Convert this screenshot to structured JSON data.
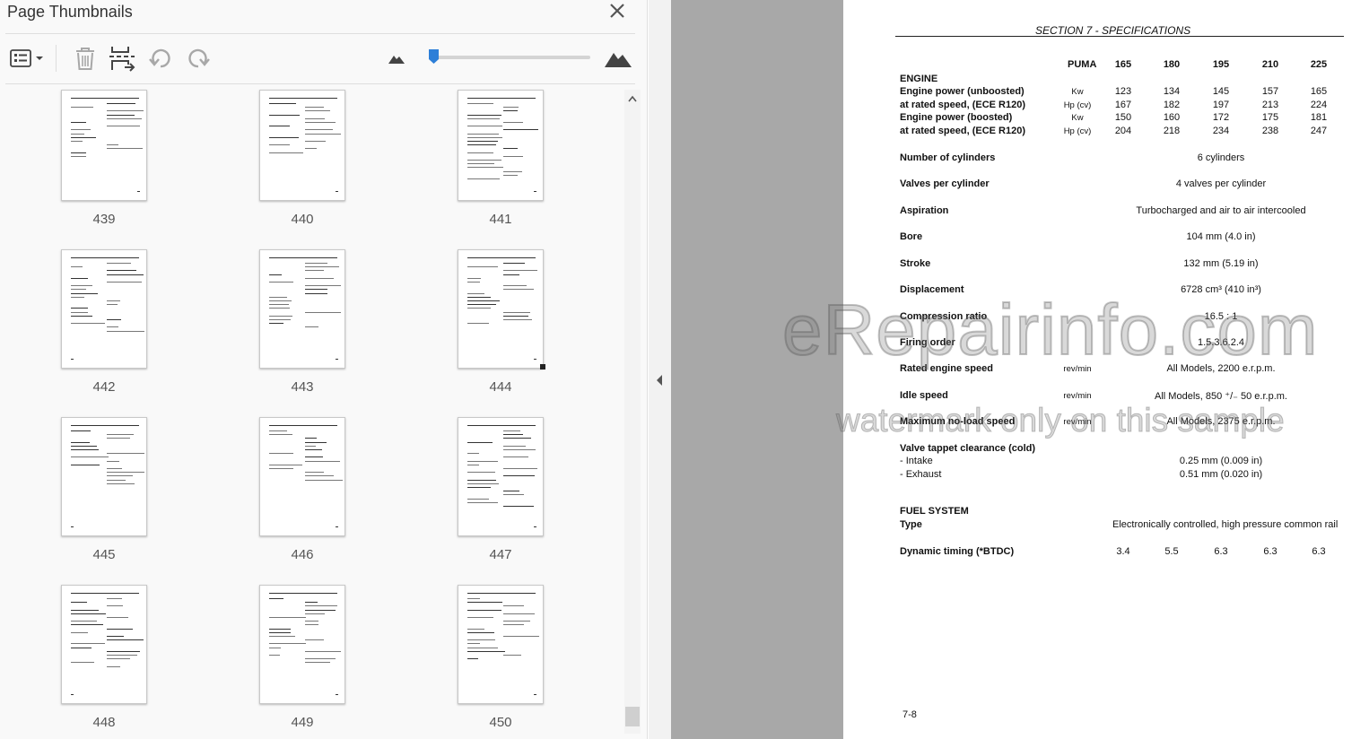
{
  "panel": {
    "title": "Page Thumbnails",
    "toolbar": {
      "options_icon": "thumbnail-options-icon",
      "delete_icon": "trash-icon",
      "extract_icon": "extract-pages-icon",
      "rotate_left_icon": "rotate-counterclockwise-icon",
      "rotate_right_icon": "rotate-clockwise-icon",
      "zoom_out_icon": "small-mountain-icon",
      "zoom_in_icon": "large-mountain-icon",
      "zoom_level": 0.03
    },
    "thumbnails": [
      {
        "label": "439"
      },
      {
        "label": "440"
      },
      {
        "label": "441"
      },
      {
        "label": "442"
      },
      {
        "label": "443"
      },
      {
        "label": "444",
        "selected": true
      },
      {
        "label": "445"
      },
      {
        "label": "446"
      },
      {
        "label": "447"
      },
      {
        "label": "448"
      },
      {
        "label": "449"
      },
      {
        "label": "450"
      }
    ]
  },
  "document": {
    "section_header": "SECTION 7  - SPECIFICATIONS",
    "model_header": "PUMA",
    "models": [
      "165",
      "180",
      "195",
      "210",
      "225"
    ],
    "engine_heading": "ENGINE",
    "power_rows": [
      {
        "label": "Engine power (unboosted)",
        "unit": "Kw",
        "values": [
          "123",
          "134",
          "145",
          "157",
          "165"
        ]
      },
      {
        "label": "at rated speed, (ECE R120)",
        "unit": "Hp (cv)",
        "values": [
          "167",
          "182",
          "197",
          "213",
          "224"
        ]
      },
      {
        "label": "Engine power (boosted)",
        "unit": "Kw",
        "values": [
          "150",
          "160",
          "172",
          "175",
          "181"
        ]
      },
      {
        "label": "at rated speed, (ECE R120)",
        "unit": "Hp (cv)",
        "values": [
          "204",
          "218",
          "234",
          "238",
          "247"
        ]
      }
    ],
    "specs": [
      {
        "label": "Number of cylinders",
        "unit": "",
        "value": "6 cylinders"
      },
      {
        "label": "Valves per cylinder",
        "unit": "",
        "value": "4 valves per cylinder"
      },
      {
        "label": "Aspiration",
        "unit": "",
        "value": "Turbocharged and air to air intercooled"
      },
      {
        "label": "Bore",
        "unit": "",
        "value": "104 mm (4.0 in)"
      },
      {
        "label": "Stroke",
        "unit": "",
        "value": "132 mm (5.19 in)"
      },
      {
        "label": "Displacement",
        "unit": "",
        "value": "6728 cm³ (410 in³)"
      },
      {
        "label": "Compression ratio",
        "unit": "",
        "value": "16.5 : 1"
      },
      {
        "label": "Firing order",
        "unit": "",
        "value": "1.5.3.6.2.4"
      },
      {
        "label": "Rated engine speed",
        "unit": "rev/min",
        "value": "All Models, 2200 e.r.p.m."
      },
      {
        "label": "Idle speed",
        "unit": "rev/min",
        "value": "All Models, 850 ⁺/₋ 50 e.r.p.m."
      },
      {
        "label": "Maximum no-load speed",
        "unit": "rev/min",
        "value": "All Models, 2375 e.r.p.m."
      }
    ],
    "tappet_heading": "Valve tappet clearance (cold)",
    "tappet_rows": [
      {
        "label": "- Intake",
        "value": "0.25 mm (0.009 in)"
      },
      {
        "label": "- Exhaust",
        "value": "0.51 mm (0.020 in)"
      }
    ],
    "fuel_heading": "FUEL SYSTEM",
    "fuel_type_label": "Type",
    "fuel_type_value": "Electronically controlled, high pressure common rail",
    "timing_label": "Dynamic timing (*BTDC)",
    "timing_values": [
      "3.4",
      "5.5",
      "6.3",
      "6.3",
      "6.3"
    ],
    "page_number": "7-8"
  },
  "watermark": {
    "line1": "eRepairinfo.com",
    "line2": "watermark only on this sample"
  }
}
